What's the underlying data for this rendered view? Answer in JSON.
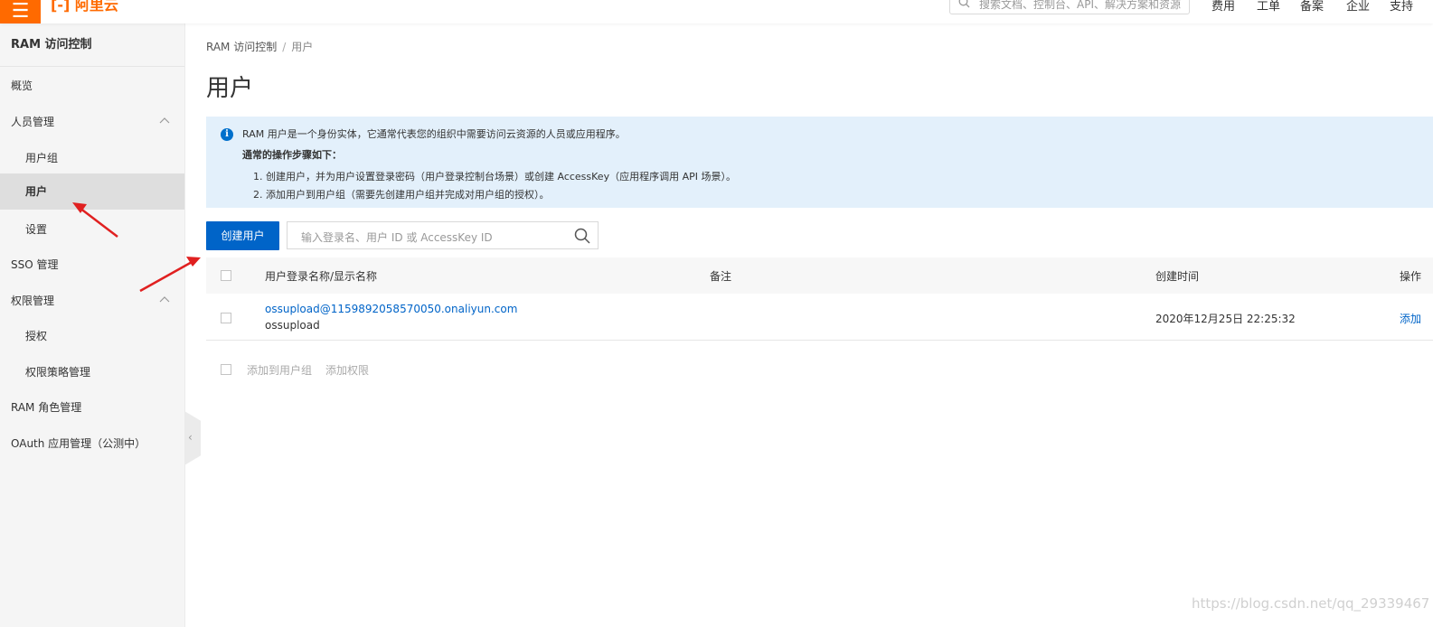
{
  "header": {
    "menu_glyph": "☰",
    "logo_text": "[-] 阿里云",
    "search_placeholder": "搜索文档、控制台、API、解决方案和资源",
    "nav": [
      "费用",
      "工单",
      "备案",
      "企业",
      "支持"
    ]
  },
  "sidebar": {
    "title": "RAM 访问控制",
    "items": [
      {
        "label": "概览"
      },
      {
        "label": "人员管理"
      },
      {
        "label": "用户组"
      },
      {
        "label": "用户"
      },
      {
        "label": "设置"
      },
      {
        "label": "SSO 管理"
      },
      {
        "label": "权限管理"
      },
      {
        "label": "授权"
      },
      {
        "label": "权限策略管理"
      },
      {
        "label": "RAM 角色管理"
      },
      {
        "label": "OAuth 应用管理（公测中）"
      }
    ],
    "collapse_glyph": "‹"
  },
  "breadcrumb": {
    "root": "RAM 访问控制",
    "separator": "/",
    "current": "用户"
  },
  "page_title": "用户",
  "notice": {
    "icon_glyph": "i",
    "line1": "RAM 用户是一个身份实体，它通常代表您的组织中需要访问云资源的人员或应用程序。",
    "line2": "通常的操作步骤如下：",
    "line3": "1. 创建用户，并为用户设置登录密码（用户登录控制台场景）或创建 AccessKey（应用程序调用 API 场景）。",
    "line4": "2. 添加用户到用户组（需要先创建用户组并完成对用户组的授权）。"
  },
  "toolbar": {
    "create_label": "创建用户",
    "search_placeholder": "输入登录名、用户 ID 或 AccessKey ID"
  },
  "table": {
    "columns": [
      "用户登录名称/显示名称",
      "备注",
      "创建时间",
      "操作"
    ],
    "rows": [
      {
        "login": "ossupload@1159892058570050.onaliyun.com",
        "display": "ossupload",
        "note": "",
        "created": "2020年12月25日 22:25:32",
        "action": "添加"
      }
    ]
  },
  "bulk_actions": {
    "add_to_group": "添加到用户组",
    "add_permission": "添加权限"
  },
  "watermark": "https://blog.csdn.net/qq_29339467",
  "colors": {
    "brand": "#ff6a00",
    "primary": "#0064c8",
    "notice_bg": "#e3f0fb",
    "annotation": "#e02020"
  }
}
